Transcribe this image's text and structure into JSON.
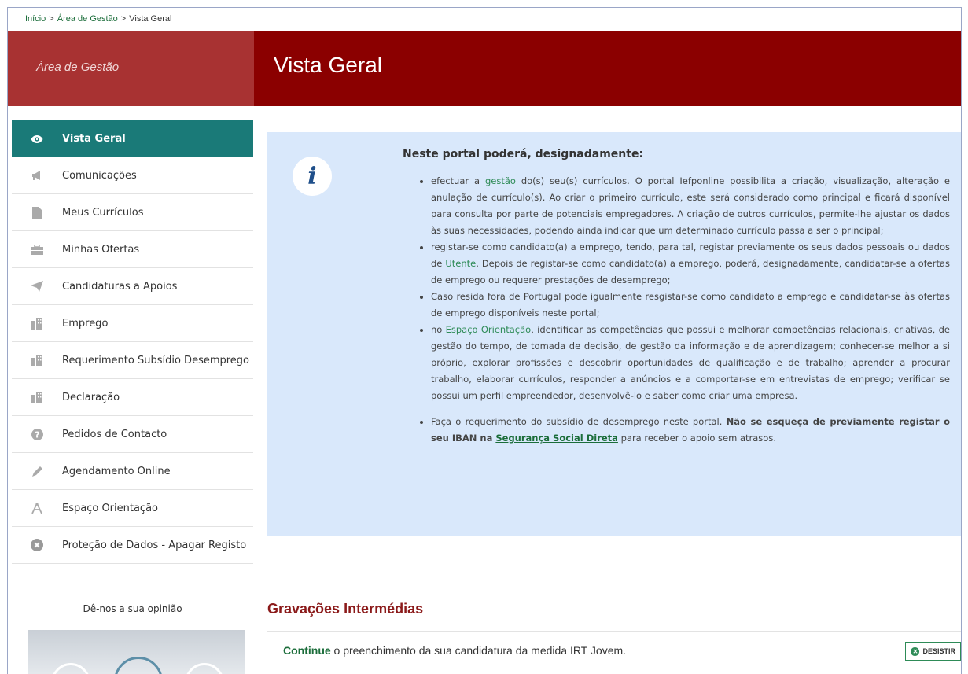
{
  "breadcrumb": {
    "home": "Início",
    "area": "Área de Gestão",
    "current": "Vista Geral"
  },
  "header": {
    "section": "Área de Gestão",
    "title": "Vista Geral"
  },
  "sidebar": {
    "items": [
      {
        "label": "Vista Geral",
        "icon": "eye-icon"
      },
      {
        "label": "Comunicações",
        "icon": "megaphone-icon"
      },
      {
        "label": "Meus Currículos",
        "icon": "document-icon"
      },
      {
        "label": "Minhas Ofertas",
        "icon": "briefcase-icon"
      },
      {
        "label": "Candidaturas a Apoios",
        "icon": "paper-plane-icon"
      },
      {
        "label": "Emprego",
        "icon": "building-icon"
      },
      {
        "label": "Requerimento Subsídio Desemprego",
        "icon": "building-icon"
      },
      {
        "label": "Declaração",
        "icon": "building-icon"
      },
      {
        "label": "Pedidos de Contacto",
        "icon": "question-icon"
      },
      {
        "label": "Agendamento Online",
        "icon": "pencil-icon"
      },
      {
        "label": "Espaço Orientação",
        "icon": "compass-icon"
      },
      {
        "label": "Proteção de Dados - Apagar Registo",
        "icon": "close-circle-icon"
      }
    ],
    "opinion": "Dê-nos a sua opinião"
  },
  "info": {
    "title": "Neste portal poderá, designadamente:",
    "b1_pre": "efectuar a ",
    "b1_link": "gestão",
    "b1_post": " do(s) seu(s) currículos. O portal Iefponline possibilita a criação, visualização, alteração e anulação de currículo(s). Ao criar o primeiro currículo, este será considerado como principal e ficará disponível para consulta por parte de potenciais empregadores. A criação de outros currículos, permite-lhe ajustar os dados às suas necessidades, podendo ainda indicar que um determinado currículo passa a ser o principal;",
    "b2_pre": "registar-se como candidato(a) a emprego, tendo, para tal, registar previamente os seus dados pessoais ou dados de ",
    "b2_link": "Utente",
    "b2_post": ". Depois de registar-se como candidato(a) a emprego, poderá, designadamente, candidatar-se a ofertas de emprego ou requerer prestações de desemprego;",
    "b3": "Caso resida fora de Portugal pode igualmente resgistar-se como candidato a emprego e candidatar-se às ofertas de emprego disponíveis neste portal;",
    "b4_pre": "no ",
    "b4_link": "Espaço Orientação",
    "b4_post": ", identificar as competências que possui e melhorar competências relacionais, criativas, de gestão do tempo, de tomada de decisão, de gestão da informação e de aprendizagem; conhecer-se melhor a si próprio, explorar profissões e descobrir oportunidades de qualificação e de trabalho; aprender a procurar trabalho, elaborar currículos, responder a anúncios e a comportar-se em entrevistas de emprego; verificar se possui um perfil empreendedor, desenvolvê-lo e saber como criar uma empresa.",
    "b5_pre": "Faça o requerimento do subsídio de desemprego neste portal. ",
    "b5_bold": "Não se esqueça de previamente registar o seu IBAN na ",
    "b5_link": "Segurança Social Direta",
    "b5_post": " para receber o apoio sem atrasos."
  },
  "gravacoes": {
    "title": "Gravações Intermédias",
    "continue_link": "Continue",
    "continue_text": " o preenchimento da sua candidatura da medida IRT Jovem.",
    "desistir": "DESISTIR"
  }
}
